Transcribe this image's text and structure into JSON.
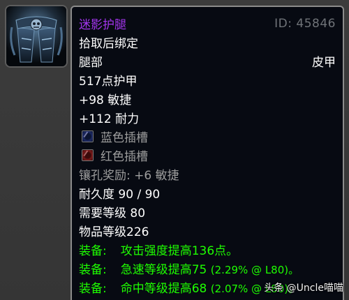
{
  "item": {
    "name": "迷影护腿",
    "id_label": "ID: 45846",
    "bind": "拾取后绑定",
    "slot": "腿部",
    "armor_type": "皮甲",
    "armor": "517点护甲",
    "stats": [
      "+98 敏捷",
      "+112 耐力"
    ],
    "sockets": [
      {
        "label": "蓝色插槽",
        "color": "blue"
      },
      {
        "label": "红色插槽",
        "color": "red"
      }
    ],
    "socket_bonus": "镶孔奖励: +6 敏捷",
    "durability": "耐久度 90 / 90",
    "required_level": "需要等级 80",
    "item_level": "物品等级226",
    "equip_effects": [
      {
        "label": "装备:",
        "text": "攻击强度提高136点。",
        "note": ""
      },
      {
        "label": "装备:",
        "text": "急速等级提高75",
        "note": "(2.29% @ L80)。"
      },
      {
        "label": "装备:",
        "text": "命中等级提高68",
        "note": "(2.07% @ L80)。"
      }
    ]
  },
  "colors": {
    "epic_name": "#a335ee",
    "equip_green": "#1eff00",
    "disabled_gray": "#9d9d9d",
    "id_gray": "#6f7378"
  },
  "watermark": {
    "text": "头条 @Uncle喵喵"
  }
}
